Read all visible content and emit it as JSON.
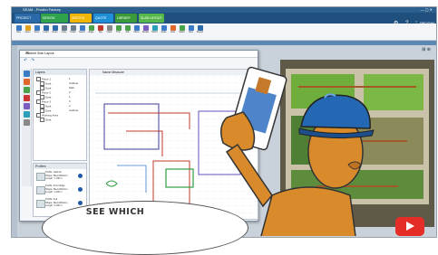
{
  "app": {
    "title": "SEAM - Prodim Factory",
    "window_controls": "— ▢ ✕",
    "brand": "PRODIM"
  },
  "tabs": [
    {
      "label": "PROJECT HOME",
      "color": "#2a6aa8"
    },
    {
      "label": "DESIGN ADVANCED",
      "color": "#2fa34b"
    },
    {
      "label": "SKETCH",
      "color": "#f2b705"
    },
    {
      "label": "QUOTE",
      "color": "#1e8fd6"
    },
    {
      "label": "LIBRARY",
      "color": "#3b9b3b"
    },
    {
      "label": "SLAB LAYOUT",
      "color": "#57b84a"
    }
  ],
  "ribbon": {
    "buttons": [
      "New",
      "Open",
      "Save",
      "Undo",
      "Redo",
      "Copy",
      "Paste",
      "Select",
      "Edge",
      "Tag",
      "Clear",
      "Trim",
      "Join",
      "Move",
      "Rotate",
      "Mirror",
      "Scale",
      "Auto",
      "Slabs",
      "Next",
      "Report"
    ]
  },
  "dialog": {
    "title": "Cabinet Slab Layout",
    "close": "✕",
    "layers_header": "Layers",
    "layers": [
      {
        "name": "Piece 1",
        "value": "1"
      },
      {
        "name": "Dark",
        "value": "Cabinet"
      },
      {
        "name": "Dark",
        "value": "Slab"
      },
      {
        "name": "Piece 2",
        "value": "2"
      },
      {
        "name": "Dark",
        "value": "1"
      },
      {
        "name": "Piece 3",
        "value": "3"
      },
      {
        "name": "Dark",
        "value": "2"
      },
      {
        "name": "Dark",
        "value": "Cabinet"
      },
      {
        "name": "Working Area",
        "value": ""
      },
      {
        "name": "Dark",
        "value": ""
      }
    ],
    "profiles_header": "Profiles",
    "profiles": [
      {
        "line1": "Profile: Cabinet",
        "line2": "Shape: Bevel-Bottom",
        "line3": "Length: 1.748 m"
      },
      {
        "line1": "Profile: Front Edge",
        "line2": "Shape: Bevel-Bottom",
        "line3": "Length: 1.200 m"
      },
      {
        "line1": "Profile: Full",
        "line2": "Shape: Bevel-Bottom",
        "line3": "Length: 2.400 m"
      }
    ],
    "canvas_header": "Name Measure"
  },
  "overlay": {
    "speech_text": "SEE WHICH"
  },
  "colors": {
    "accent": "#1f4f7d",
    "youtube": "#e52d27",
    "hardhat": "#2467b3",
    "mannequin": "#d98b2b"
  }
}
